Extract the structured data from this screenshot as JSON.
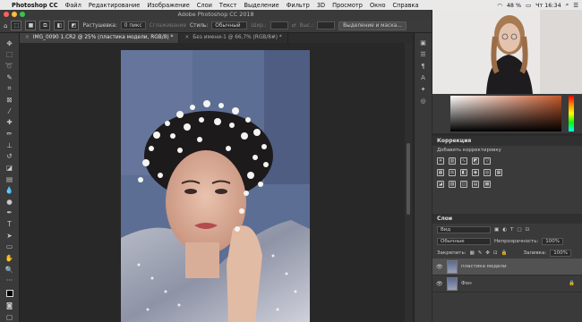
{
  "menubar": {
    "app": "Photoshop CC",
    "items": [
      "Файл",
      "Редактирование",
      "Изображение",
      "Слои",
      "Текст",
      "Выделение",
      "Фильтр",
      "3D",
      "Просмотр",
      "Окно",
      "Справка"
    ],
    "battery": "48 %",
    "clock": "Чт 16:34"
  },
  "window_title": "Adobe Photoshop CC 2018",
  "options": {
    "feather_label": "Растушевка:",
    "feather_value": "0 пикс",
    "antialias": "Сглаживание",
    "style_label": "Стиль:",
    "style_value": "Обычный",
    "width_label": "Шир.:",
    "height_label": "Выс.:",
    "select_mask": "Выделение и маска..."
  },
  "tabs": [
    "IMG_0090 1.CR2 @ 25% (пластика модели, RGB/8) *",
    "Без имени-1 @ 66,7% (RGB/8#) *"
  ],
  "adjustments": {
    "title": "Коррекция",
    "subtitle": "Добавить корректировку"
  },
  "layers": {
    "title": "Слои",
    "filter": "Вид",
    "blend": "Обычные",
    "opacity_label": "Непрозрачность:",
    "opacity": "100%",
    "lock_label": "Закрепить:",
    "fill_label": "Заливка:",
    "fill": "100%",
    "items": [
      {
        "name": "пластика модели",
        "active": true
      },
      {
        "name": "Фон",
        "active": false
      }
    ]
  }
}
